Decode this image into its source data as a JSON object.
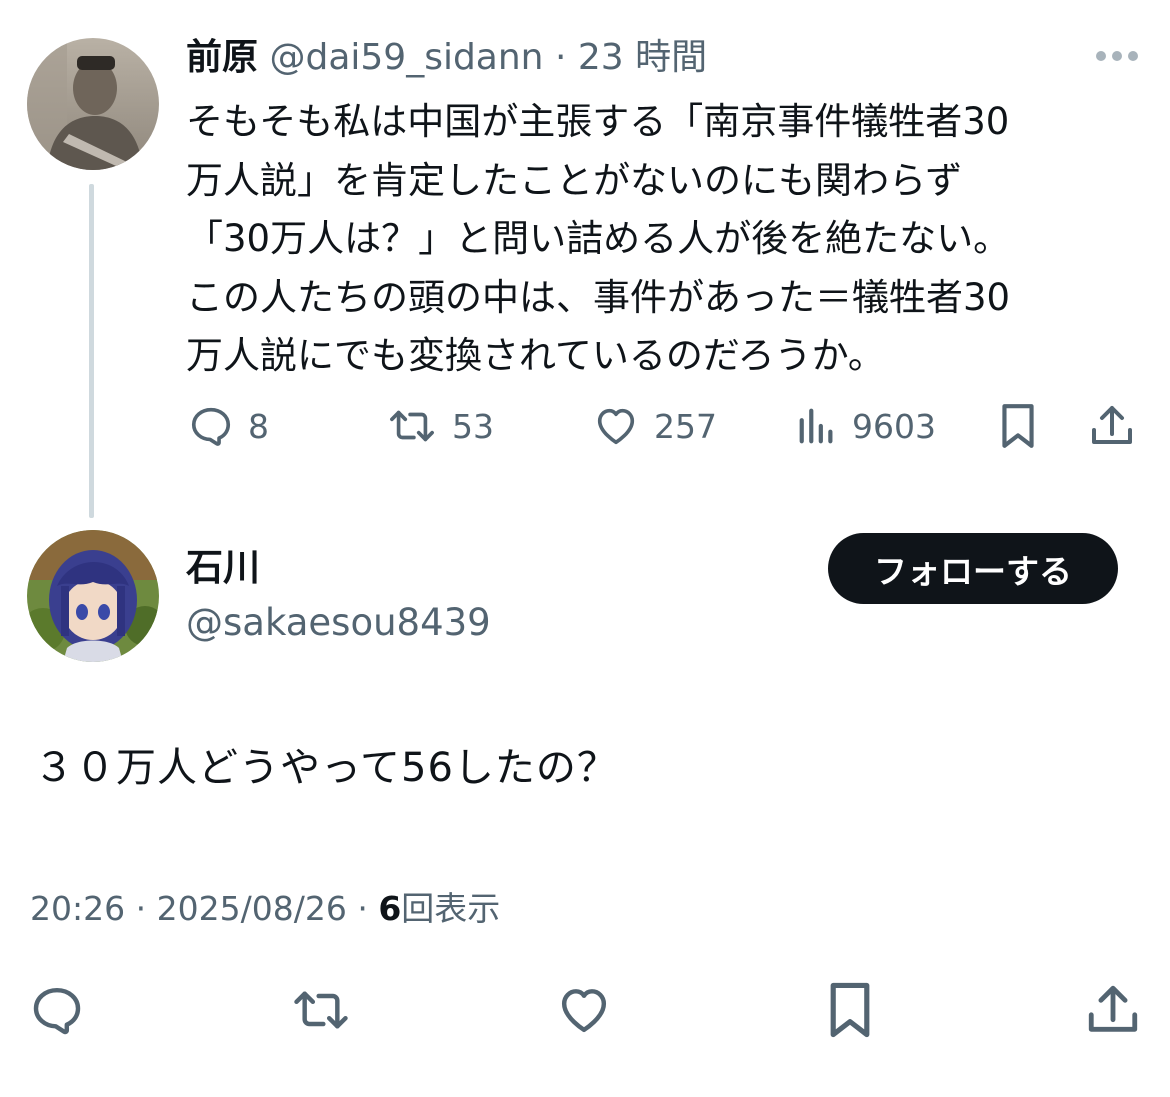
{
  "parent_tweet": {
    "display_name": "前原",
    "handle": "@dai59_sidann",
    "separator": "·",
    "time": "23 時間",
    "lines": [
      "そもそも私は中国が主張する「南京事件犠牲者30",
      "万人説」を肯定したことがないのにも関わらず",
      "「30万人は？」と問い詰める人が後を絶たない。",
      "この人たちの頭の中は、事件があった＝犠牲者30",
      "万人説にでも変換されているのだろうか。"
    ],
    "replies": "8",
    "retweets": "53",
    "likes": "257",
    "views": "9603",
    "more_icon": "more-horizontal-icon",
    "colors": {
      "text": "#0f1419",
      "secondary": "#536471",
      "thread_line": "#cfd9de"
    }
  },
  "reply_tweet": {
    "display_name": "石川",
    "handle": "@sakaesou8439",
    "follow_label": "フォローする",
    "text": "３０万人どうやって56したの？",
    "time": "20:26",
    "separator": "·",
    "date": "2025/08/26",
    "views_count": "6",
    "views_label": "回表示",
    "colors": {
      "follow_bg": "#0f1419",
      "follow_text": "#ffffff"
    }
  },
  "icons": [
    "reply-icon",
    "retweet-icon",
    "like-icon",
    "views-icon",
    "bookmark-icon",
    "share-icon"
  ]
}
